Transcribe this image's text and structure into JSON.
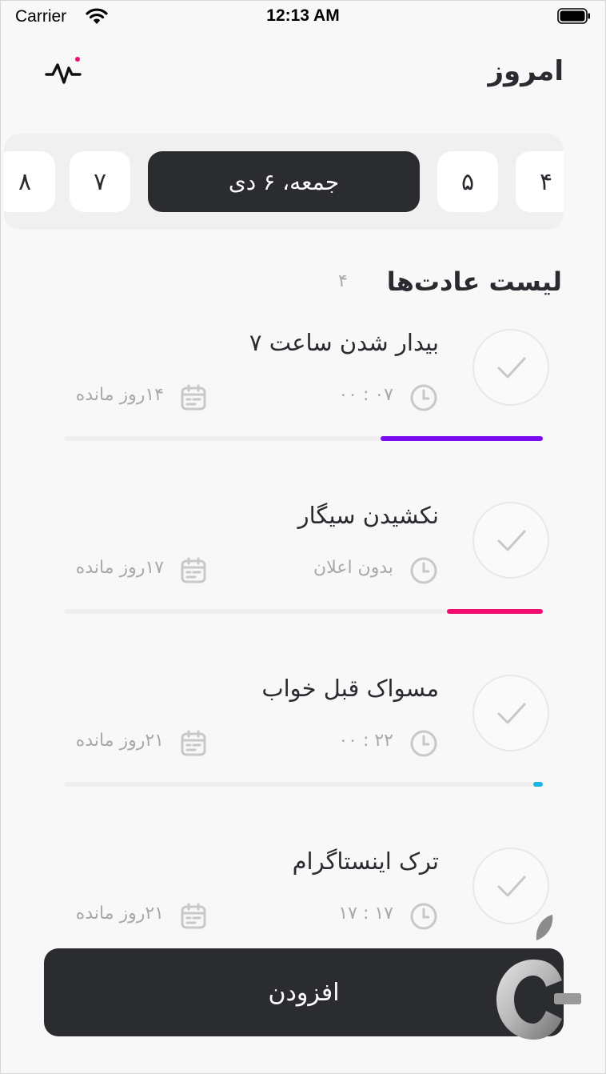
{
  "status_bar": {
    "carrier": "Carrier",
    "time": "12:13 AM"
  },
  "header": {
    "title": "امروز",
    "activity_icon": "pulse-icon"
  },
  "date_strip": {
    "items": [
      {
        "label": "۸",
        "active": false
      },
      {
        "label": "۷",
        "active": false
      },
      {
        "label": "جمعه، ۶ دی",
        "active": true
      },
      {
        "label": "۵",
        "active": false
      },
      {
        "label": "۴",
        "active": false
      }
    ]
  },
  "habits_section": {
    "title": "لیست عادت‌ها",
    "count": "۴"
  },
  "habits": [
    {
      "title": "بیدار شدن ساعت ۷",
      "time": "۰۷ : ۰۰",
      "remaining": "۱۴روز مانده",
      "progress": 0.34,
      "color": "#7b0cf2"
    },
    {
      "title": "نکشیدن سیگار",
      "time": "بدون اعلان",
      "remaining": "۱۷روز مانده",
      "progress": 0.2,
      "color": "#f20c70"
    },
    {
      "title": "مسواک قبل خواب",
      "time": "۲۲ : ۰۰",
      "remaining": "۲۱روز مانده",
      "progress": 0.02,
      "color": "#1ab3e6"
    },
    {
      "title": "ترک اینستاگرام",
      "time": "۱۷ : ۱۷",
      "remaining": "۲۱روز مانده",
      "progress": 0,
      "color": "#cccccc"
    }
  ],
  "add_button": {
    "label": "افزودن"
  },
  "colors": {
    "dark": "#2b2c30",
    "background": "#f8f8f8",
    "muted": "#a8a8a8"
  }
}
